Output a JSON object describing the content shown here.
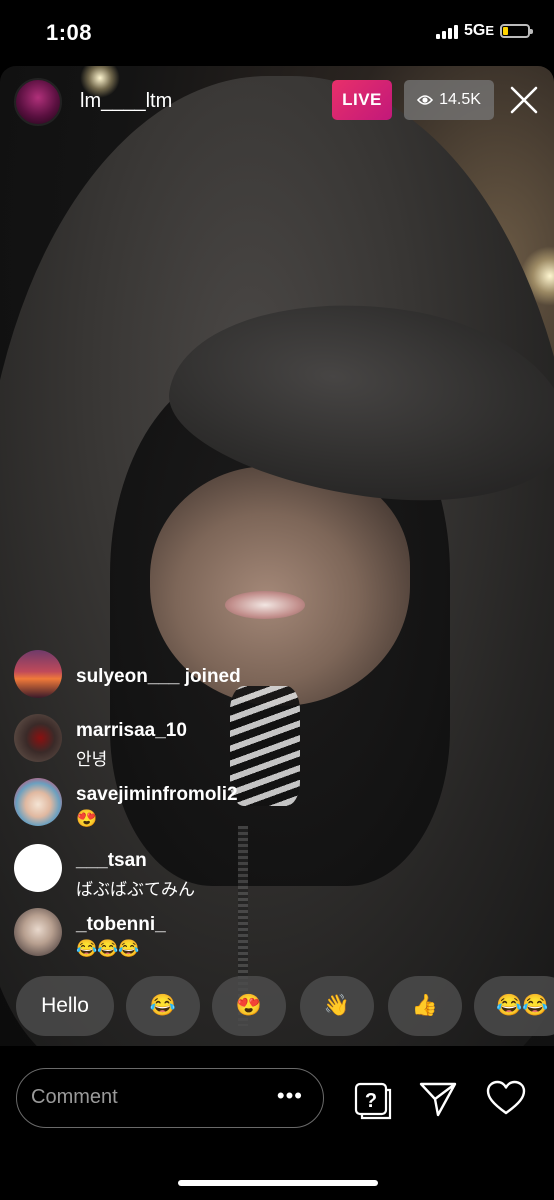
{
  "status_bar": {
    "time": "1:08",
    "network": "5G",
    "network_suffix": "E",
    "battery_level": 0.2,
    "battery_color": "#ffd400"
  },
  "live": {
    "host_username": "lm____ltm",
    "live_label": "LIVE",
    "viewer_count": "14.5K",
    "live_badge_color": "#d81b6a"
  },
  "comments": [
    {
      "username": "sulyeon___",
      "text": "joined",
      "type": "joined",
      "avatar": "sunset-avatar"
    },
    {
      "username": "marrisaa_10",
      "text": "안녕",
      "type": "comment",
      "avatar": "rose-avatar"
    },
    {
      "username": "savejiminfromoli2",
      "text": "😍",
      "type": "comment",
      "avatar": "clown-avatar"
    },
    {
      "username": "___tsan",
      "text": "ばぶばぶてみん",
      "type": "comment",
      "avatar": "blank-avatar"
    },
    {
      "username": "_tobenni_",
      "text": "😂😂😂",
      "type": "comment",
      "avatar": "person-avatar"
    }
  ],
  "quick_replies": [
    "Hello",
    "😂",
    "😍",
    "👋",
    "👍",
    "😂😂"
  ],
  "composer": {
    "placeholder": "Comment",
    "more_label": "•••"
  },
  "icons": {
    "close": "close-icon",
    "viewers": "eye-icon",
    "question": "question-box-icon",
    "send": "paper-plane-icon",
    "like": "heart-icon"
  }
}
